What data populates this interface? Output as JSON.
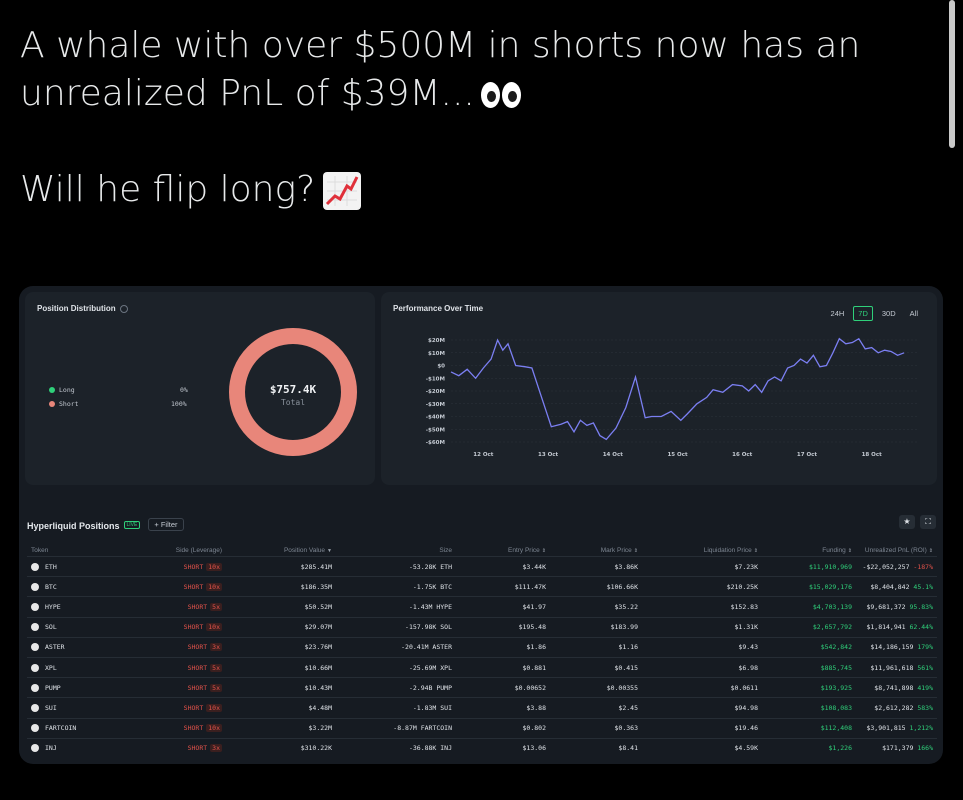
{
  "tweet": {
    "line1": "A whale with over $500M in shorts now has an",
    "line2": "unrealized PnL of $39M...",
    "line3": "Will he flip long?",
    "emoji1": "eyes-emoji",
    "emoji2": "chart-increasing-emoji"
  },
  "distribution": {
    "title": "Position Distribution",
    "long_label": "Long",
    "long_pct": "0%",
    "short_label": "Short",
    "short_pct": "100%",
    "total_value": "$757.4K",
    "total_label": "Total",
    "colors": {
      "long": "#2fd07a",
      "short": "#e8867a"
    }
  },
  "performance": {
    "title": "Performance Over Time",
    "timeframes": [
      "24H",
      "7D",
      "30D",
      "All"
    ],
    "active_timeframe": "7D"
  },
  "chart_data": {
    "type": "line",
    "title": "Performance Over Time",
    "y_ticks": [
      "$20M",
      "$10M",
      "$0",
      "-$10M",
      "-$20M",
      "-$30M",
      "-$40M",
      "-$50M",
      "-$60M"
    ],
    "ylim": [
      -60,
      20
    ],
    "x_ticks": [
      "12 Oct",
      "13 Oct",
      "14 Oct",
      "15 Oct",
      "16 Oct",
      "17 Oct",
      "18 Oct"
    ],
    "xlim": [
      0,
      7.2
    ],
    "line_color": "#7b7ff2",
    "series": [
      {
        "unit": "$M",
        "x": [
          0,
          0.12,
          0.25,
          0.38,
          0.5,
          0.62,
          0.72,
          0.8,
          0.88,
          1.0,
          1.15,
          1.25,
          1.4,
          1.55,
          1.7,
          1.8,
          1.9,
          2.0,
          2.1,
          2.2,
          2.3,
          2.4,
          2.55,
          2.7,
          2.85,
          3.0,
          3.1,
          3.25,
          3.4,
          3.55,
          3.65,
          3.8,
          3.95,
          4.05,
          4.2,
          4.35,
          4.5,
          4.6,
          4.7,
          4.8,
          4.9,
          5.0,
          5.1,
          5.2,
          5.3,
          5.4,
          5.5,
          5.6,
          5.7,
          5.8,
          5.9,
          6.0,
          6.1,
          6.2,
          6.3,
          6.4,
          6.5,
          6.6,
          6.7,
          6.8,
          6.9,
          7.0
        ],
        "y": [
          -5,
          -8,
          -3,
          -10,
          -2,
          5,
          20,
          12,
          17,
          0,
          -1,
          -2,
          -25,
          -48,
          -46,
          -44,
          -52,
          -43,
          -47,
          -45,
          -55,
          -58,
          -49,
          -33,
          -9,
          -41,
          -40,
          -40,
          -36,
          -43,
          -38,
          -30,
          -25,
          -19,
          -21,
          -15,
          -16,
          -20,
          -15,
          -21,
          -12,
          -9,
          -12,
          -2,
          0,
          5,
          2,
          8,
          -1,
          0,
          10,
          21,
          17,
          18,
          21,
          13,
          14,
          10,
          12,
          11,
          8,
          10
        ]
      }
    ]
  },
  "positions": {
    "title": "Hyperliquid Positions",
    "live_badge": "LIVE",
    "filter_label": "+ Filter",
    "columns": [
      "Token",
      "Side (Leverage)",
      "Position Value",
      "Size",
      "Entry Price",
      "Mark Price",
      "Liquidation Price",
      "Funding",
      "Unrealized PnL (ROI)"
    ],
    "rows": [
      {
        "token": "ETH",
        "side": "SHORT",
        "lev": "10x",
        "value": "$285.41M",
        "size": "-53.28K ETH",
        "entry": "$3.44K",
        "mark": "$3.86K",
        "liq": "$7.23K",
        "funding": "$11,910,969",
        "pnl": "-$22,052,257",
        "roi": "-187%"
      },
      {
        "token": "BTC",
        "side": "SHORT",
        "lev": "10x",
        "value": "$186.35M",
        "size": "-1.75K BTC",
        "entry": "$111.47K",
        "mark": "$106.66K",
        "liq": "$210.25K",
        "funding": "$15,029,176",
        "pnl": "$8,404,842",
        "roi": "45.1%"
      },
      {
        "token": "HYPE",
        "side": "SHORT",
        "lev": "5x",
        "value": "$50.52M",
        "size": "-1.43M HYPE",
        "entry": "$41.97",
        "mark": "$35.22",
        "liq": "$152.83",
        "funding": "$4,703,139",
        "pnl": "$9,681,372",
        "roi": "95.83%"
      },
      {
        "token": "SOL",
        "side": "SHORT",
        "lev": "10x",
        "value": "$29.07M",
        "size": "-157.98K SOL",
        "entry": "$195.48",
        "mark": "$183.99",
        "liq": "$1.31K",
        "funding": "$2,657,792",
        "pnl": "$1,814,941",
        "roi": "62.44%"
      },
      {
        "token": "ASTER",
        "side": "SHORT",
        "lev": "3x",
        "value": "$23.76M",
        "size": "-20.41M ASTER",
        "entry": "$1.86",
        "mark": "$1.16",
        "liq": "$9.43",
        "funding": "$542,842",
        "pnl": "$14,186,159",
        "roi": "179%"
      },
      {
        "token": "XPL",
        "side": "SHORT",
        "lev": "5x",
        "value": "$10.66M",
        "size": "-25.69M XPL",
        "entry": "$0.881",
        "mark": "$0.415",
        "liq": "$6.98",
        "funding": "$885,745",
        "pnl": "$11,961,618",
        "roi": "561%"
      },
      {
        "token": "PUMP",
        "side": "SHORT",
        "lev": "5x",
        "value": "$10.43M",
        "size": "-2.94B PUMP",
        "entry": "$0.00652",
        "mark": "$0.00355",
        "liq": "$0.0611",
        "funding": "$193,925",
        "pnl": "$8,741,898",
        "roi": "419%"
      },
      {
        "token": "SUI",
        "side": "SHORT",
        "lev": "10x",
        "value": "$4.48M",
        "size": "-1.83M SUI",
        "entry": "$3.88",
        "mark": "$2.45",
        "liq": "$94.98",
        "funding": "$108,083",
        "pnl": "$2,612,282",
        "roi": "583%"
      },
      {
        "token": "FARTCOIN",
        "side": "SHORT",
        "lev": "10x",
        "value": "$3.22M",
        "size": "-8.87M FARTCOIN",
        "entry": "$0.802",
        "mark": "$0.363",
        "liq": "$19.46",
        "funding": "$112,408",
        "pnl": "$3,901,815",
        "roi": "1,212%"
      },
      {
        "token": "INJ",
        "side": "SHORT",
        "lev": "3x",
        "value": "$310.22K",
        "size": "-36.88K INJ",
        "entry": "$13.06",
        "mark": "$8.41",
        "liq": "$4.59K",
        "funding": "$1,226",
        "pnl": "$171,379",
        "roi": "166%"
      }
    ]
  }
}
